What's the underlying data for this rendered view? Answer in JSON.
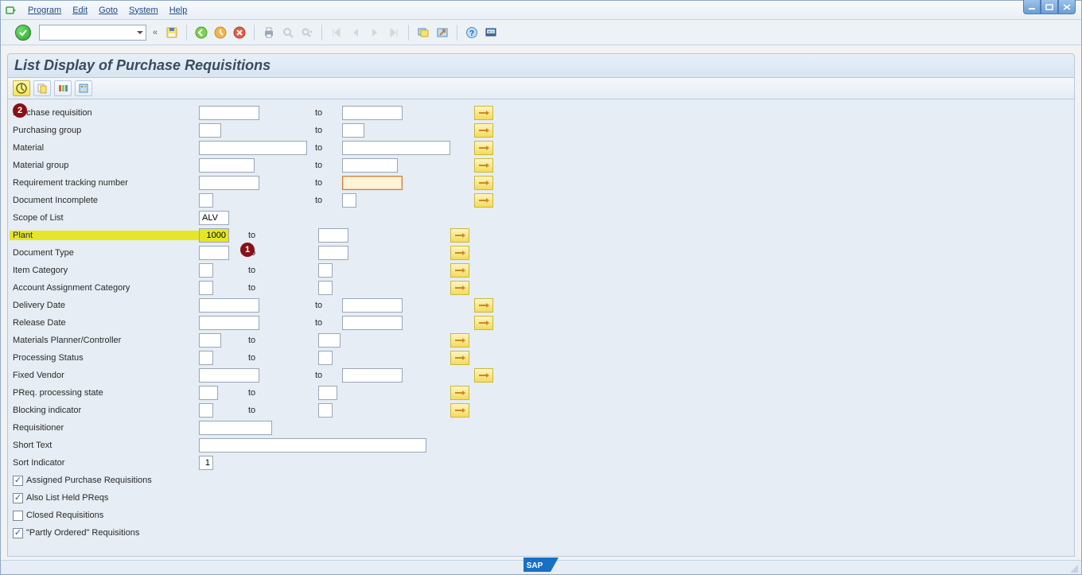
{
  "menu": {
    "items": [
      "Program",
      "Edit",
      "Goto",
      "System",
      "Help"
    ]
  },
  "title": "List Display of Purchase Requisitions",
  "toolbar_icons": {
    "enter": "enter-icon",
    "save": "save-icon",
    "back": "back-icon",
    "exit": "exit-icon",
    "cancel": "cancel-icon",
    "print": "print-icon",
    "find": "find-icon",
    "findnext": "findnext-icon",
    "first": "first-icon",
    "prev": "prev-icon",
    "next": "next-icon",
    "last": "last-icon",
    "session": "session-icon",
    "shortcut": "shortcut-icon",
    "help": "help-icon",
    "layout": "layout-icon"
  },
  "app_toolbar": {
    "execute": "execute",
    "variants": "variants",
    "choose": "choose",
    "save_variant": "save_variant"
  },
  "labels": {
    "purchase_requisition": "Purchase requisition",
    "purchasing_group": "Purchasing group",
    "material": "Material",
    "material_group": "Material group",
    "req_track_no": "Requirement tracking number",
    "doc_incomplete": "Document Incomplete",
    "scope_of_list": "Scope of List",
    "plant": "Plant",
    "document_type": "Document Type",
    "item_category": "Item Category",
    "acct_assign_cat": "Account Assignment Category",
    "delivery_date": "Delivery Date",
    "release_date": "Release Date",
    "mrp_controller": "Materials Planner/Controller",
    "processing_status": "Processing Status",
    "fixed_vendor": "Fixed Vendor",
    "preq_proc_state": "PReq. processing state",
    "blocking_indicator": "Blocking indicator",
    "requisitioner": "Requisitioner",
    "short_text": "Short Text",
    "sort_indicator": "Sort Indicator",
    "assigned_pr": "Assigned Purchase Requisitions",
    "also_list_held": "Also List Held PReqs",
    "closed_req": "Closed Requisitions",
    "partly_ordered": "\"Partly Ordered\" Requisitions",
    "to": "to"
  },
  "values": {
    "scope_of_list": "ALV",
    "plant_from": "1000",
    "sort_indicator": "1"
  },
  "checkboxes": {
    "assigned_pr": true,
    "also_list_held": true,
    "closed_req": false,
    "partly_ordered": true
  },
  "badges": {
    "one": "1",
    "two": "2"
  }
}
